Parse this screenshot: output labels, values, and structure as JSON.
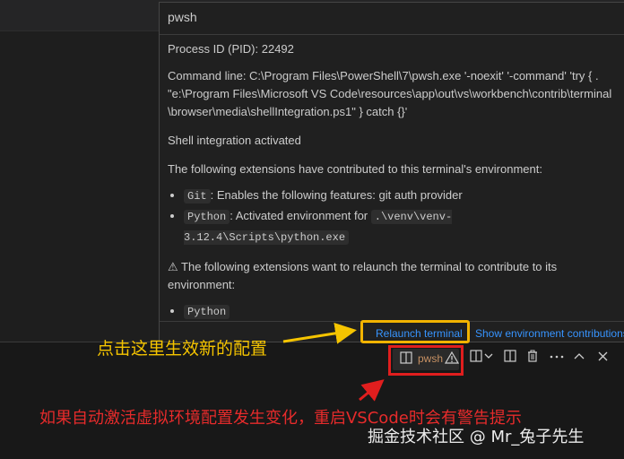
{
  "hover": {
    "title": "pwsh",
    "pid": "Process ID (PID): 22492",
    "command_line": "Command line: C:\\Program Files\\PowerShell\\7\\pwsh.exe '-noexit' '-command' 'try { . \"e:\\Program Files\\Microsoft VS Code\\resources\\app\\out\\vs\\workbench\\contrib\\terminal\\browser\\media\\shellIntegration.ps1\" } catch {}'",
    "shell_integration": "Shell integration activated",
    "contributed_intro": "The following extensions have contributed to this terminal's environment:",
    "contributions": [
      {
        "ext": "Git",
        "text": ": Enables the following features: git auth provider",
        "path": ""
      },
      {
        "ext": "Python",
        "text": ": Activated environment for ",
        "path": ".\\venv\\venv-3.12.4\\Scripts\\python.exe"
      }
    ],
    "relaunch_message": "⚠ The following extensions want to relaunch the terminal to contribute to its environment:",
    "relaunch_extensions": [
      "Python"
    ],
    "actions": {
      "relaunch": "Relaunch terminal",
      "show_env": "Show environment contributions"
    }
  },
  "terminal_tab": {
    "label": "pwsh",
    "label_color": "#c69063"
  },
  "toolbar_icons": [
    "split-icon",
    "chevron-down-icon",
    "layout-icon",
    "trash-icon",
    "more-icon",
    "chevron-up-icon",
    "close-icon"
  ],
  "annotations": {
    "click_here": "点击这里生效新的配置",
    "warning_note": "如果自动激活虚拟环境配置发生变化，重启VSCode时会有警告提示"
  },
  "watermark": "掘金技术社区 @ Mr_兔子先生",
  "colors": {
    "link": "#3794ff",
    "highlight_yellow": "#f5c400",
    "highlight_red": "#e01e1e",
    "background": "#1f1f1f"
  }
}
